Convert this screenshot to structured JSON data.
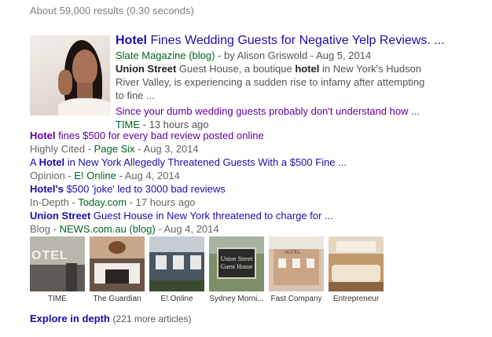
{
  "stats": "About 59,000 results (0.30 seconds)",
  "main": {
    "title_bold": "Hotel",
    "title_rest": " Fines Wedding Guests for Negative Yelp Reviews. ...",
    "source": "Slate Magazine (blog)",
    "meta_rest": " - by Alison Griswold - Aug 5, 2014",
    "snippet": [
      {
        "text": "Union Street",
        "bold": true
      },
      {
        "text": " Guest House, a boutique ",
        "bold": false
      },
      {
        "text": "hotel",
        "bold": true
      },
      {
        "text": " in New York's Hudson River Valley, is experiencing a sudden rise to infamy after attempting to fine ...",
        "bold": false
      }
    ],
    "secondary_title": "Since your dumb wedding guests probably don't understand how ...",
    "secondary_source": "TIME",
    "secondary_time": " - 13 hours ago"
  },
  "related": [
    {
      "title_bold": "Hotel",
      "title_rest": " fines $500 for every bad review posted online",
      "label": "Highly Cited - ",
      "source": "Page Six",
      "date": " - Aug 3, 2014",
      "visited": true
    },
    {
      "title_pre": "A ",
      "title_bold": "Hotel",
      "title_rest": " in New York Allegedly Threatened Guests With a $500 Fine ...",
      "label": "Opinion - ",
      "source": "E! Online",
      "date": " - Aug 4, 2014",
      "visited": false
    },
    {
      "title_bold": "Hotel's",
      "title_rest": " $500 'joke' led to 3000 bad reviews",
      "label": "In-Depth - ",
      "source": "Today.com",
      "date": " - 17 hours ago",
      "visited": false
    },
    {
      "title_bold": "Union Street",
      "title_rest": " Guest House in New York threatened to charge for ...",
      "label": "Blog - ",
      "source": "NEWS.com.au (blog)",
      "date": " - Aug 4, 2014",
      "visited": false
    }
  ],
  "images": [
    {
      "caption": "TIME"
    },
    {
      "caption": "The Guardian"
    },
    {
      "caption": "E! Online"
    },
    {
      "caption": "Sydney Morni..."
    },
    {
      "caption": "Fast Company"
    },
    {
      "caption": "Entrepreneur"
    }
  ],
  "sign_text": {
    "hotel": "OTEL",
    "sign": "Union Street Guest House",
    "small": "HOTEL"
  },
  "explore": {
    "label": "Explore in depth",
    "more": "(221 more articles)"
  }
}
